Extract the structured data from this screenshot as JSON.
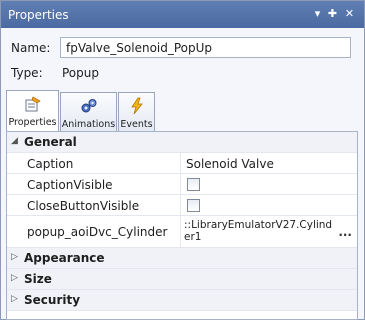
{
  "window": {
    "title": "Properties",
    "buttons": {
      "pin": "▾",
      "autohide": "✚",
      "close": "✕"
    }
  },
  "header": {
    "name_label": "Name:",
    "name_value": "fpValve_Solenoid_PopUp",
    "type_label": "Type:",
    "type_value": "Popup"
  },
  "tabs": [
    {
      "label": "Properties",
      "icon": "properties-icon",
      "active": true
    },
    {
      "label": "Animations",
      "icon": "animations-icon",
      "active": false
    },
    {
      "label": "Events",
      "icon": "events-icon",
      "active": false
    }
  ],
  "grid": {
    "general": {
      "label": "General",
      "expanded": true,
      "rows": [
        {
          "name": "Caption",
          "value": "Solenoid Valve"
        },
        {
          "name": "CaptionVisible",
          "value": false
        },
        {
          "name": "CloseButtonVisible",
          "value": false
        },
        {
          "name": "popup_aoiDvc_Cylinder",
          "value": "::LibraryEmulatorV27.Cylinder1",
          "button": "..."
        }
      ]
    },
    "categories": [
      {
        "label": "Appearance",
        "expanded": false
      },
      {
        "label": "Size",
        "expanded": false
      },
      {
        "label": "Security",
        "expanded": false
      }
    ]
  },
  "colors": {
    "titlebar": "#5170a6",
    "accent_icon": "#f0a020"
  }
}
